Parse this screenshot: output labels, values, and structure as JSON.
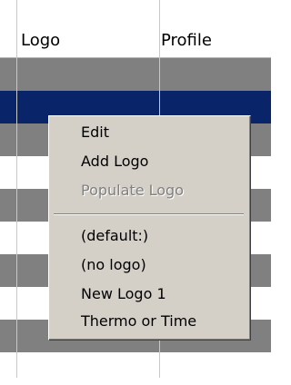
{
  "table": {
    "columns": [
      "Logo",
      "Profile"
    ]
  },
  "context_menu": {
    "items": [
      {
        "label": "Edit",
        "enabled": true
      },
      {
        "label": "Add Logo",
        "enabled": true
      },
      {
        "label": "Populate Logo",
        "enabled": false
      },
      {
        "label": "(default:)",
        "enabled": true
      },
      {
        "label": "(no logo)",
        "enabled": true
      },
      {
        "label": "New Logo 1",
        "enabled": true
      },
      {
        "label": "Thermo or Time",
        "enabled": true
      }
    ]
  },
  "colors": {
    "row_gray": "#808080",
    "row_selected": "#0a246a",
    "menu_background": "#d4d0c8",
    "disabled_text": "#808080"
  }
}
